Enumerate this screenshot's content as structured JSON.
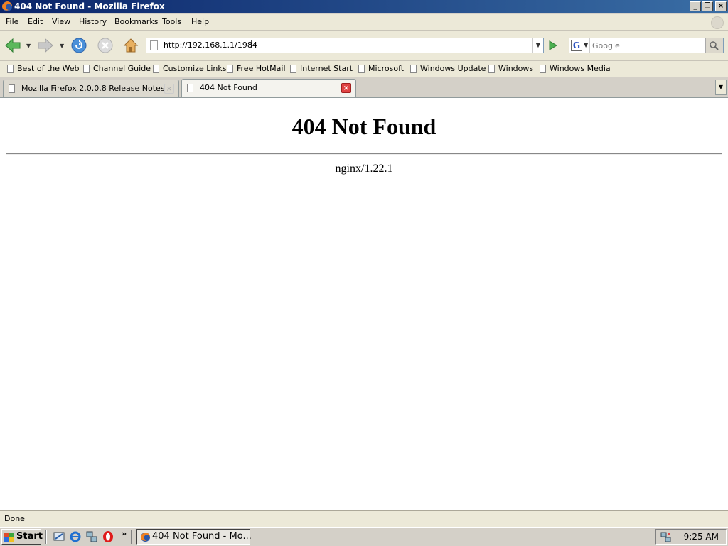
{
  "window": {
    "title": "404 Not Found - Mozilla Firefox",
    "minimize": "_",
    "restore": "❐",
    "close": "×"
  },
  "menubar": {
    "items": [
      {
        "label": "File"
      },
      {
        "label": "Edit"
      },
      {
        "label": "View"
      },
      {
        "label": "History"
      },
      {
        "label": "Bookmarks"
      },
      {
        "label": "Tools"
      },
      {
        "label": "Help"
      }
    ]
  },
  "navigation": {
    "url": "http://192.168.1.1/1984",
    "search_placeholder": "Google",
    "search_engine": "G"
  },
  "bookmarks": [
    {
      "label": "Best of the Web"
    },
    {
      "label": "Channel Guide"
    },
    {
      "label": "Customize Links"
    },
    {
      "label": "Free HotMail"
    },
    {
      "label": "Internet Start"
    },
    {
      "label": "Microsoft"
    },
    {
      "label": "Windows Update"
    },
    {
      "label": "Windows"
    },
    {
      "label": "Windows Media"
    }
  ],
  "tabs": [
    {
      "label": "Mozilla Firefox 2.0.0.8 Release Notes",
      "active": false
    },
    {
      "label": "404 Not Found",
      "active": true
    }
  ],
  "page": {
    "heading": "404 Not Found",
    "server": "nginx/1.22.1"
  },
  "status": {
    "text": "Done"
  },
  "taskbar": {
    "start_label": "Start",
    "more": "»",
    "task_label": "404 Not Found - Mo...",
    "clock": "9:25 AM"
  },
  "colors": {
    "titlebar_start": "#0a246a",
    "titlebar_end": "#3a6ea5",
    "tab_close_active": "#e04343",
    "back_arrow": "#4caf50"
  }
}
